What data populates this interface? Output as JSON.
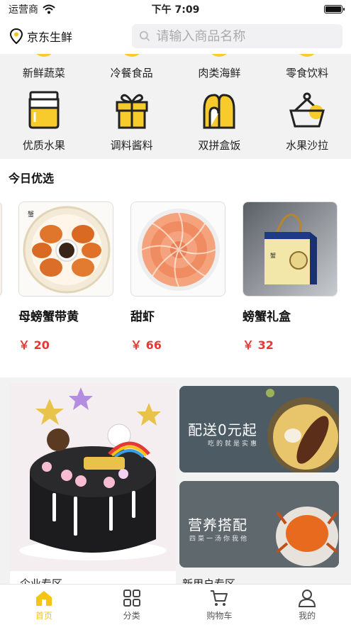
{
  "status": {
    "carrier": "运营商",
    "time": "下午 7:09"
  },
  "header": {
    "location": "京东生鲜",
    "search_placeholder": "请输入商品名称"
  },
  "categories_row1": [
    "新鲜蔬菜",
    "冷餐食品",
    "肉类海鲜",
    "零食饮料"
  ],
  "categories_row2": [
    {
      "label": "优质水果",
      "icon": "jar-icon"
    },
    {
      "label": "调料酱料",
      "icon": "gift-box-icon"
    },
    {
      "label": "双拼盒饭",
      "icon": "bento-icon"
    },
    {
      "label": "水果沙拉",
      "icon": "basket-icon"
    }
  ],
  "today": {
    "title": "今日优选",
    "products": [
      {
        "name": "母螃蟹带黄",
        "price": "￥ 20"
      },
      {
        "name": "甜虾",
        "price": "￥ 66"
      },
      {
        "name": "螃蟹礼盒",
        "price": "￥ 32"
      }
    ]
  },
  "promo": {
    "top_title": "配送0元起",
    "top_sub": "吃的就是实惠",
    "bottom_title": "营养搭配",
    "bottom_sub": "四菜一汤你我他",
    "left_label": "企业专区",
    "right_label": "新用户专区"
  },
  "tabs": [
    {
      "label": "首页",
      "icon": "home-icon",
      "active": true
    },
    {
      "label": "分类",
      "icon": "grid-icon",
      "active": false
    },
    {
      "label": "购物车",
      "icon": "cart-icon",
      "active": false
    },
    {
      "label": "我的",
      "icon": "user-icon",
      "active": false
    }
  ],
  "colors": {
    "accent": "#f7c314",
    "price": "#e53935"
  }
}
